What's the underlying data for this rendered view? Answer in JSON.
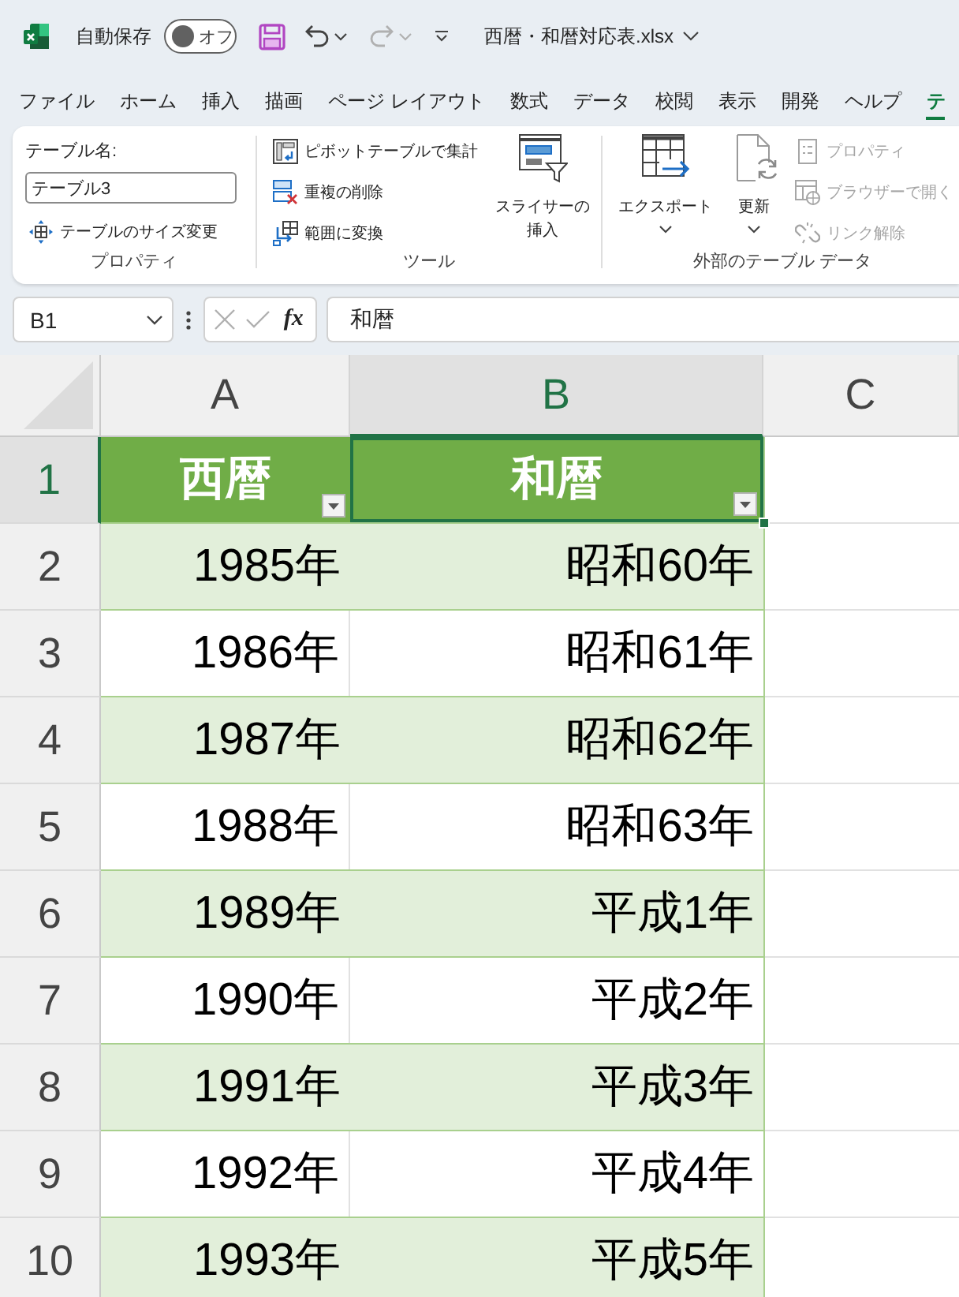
{
  "title_bar": {
    "autosave_label": "自動保存",
    "autosave_toggle": {
      "label": "オフ",
      "on": false
    },
    "undo": {
      "disabled": false
    },
    "redo": {
      "disabled": true
    },
    "file_name": "西暦・和暦対応表.xlsx"
  },
  "ribbon_tabs": [
    {
      "label": "ファイル",
      "selected": false
    },
    {
      "label": "ホーム",
      "selected": false
    },
    {
      "label": "挿入",
      "selected": false
    },
    {
      "label": "描画",
      "selected": false
    },
    {
      "label": "ページ レイアウト",
      "selected": false
    },
    {
      "label": "数式",
      "selected": false
    },
    {
      "label": "データ",
      "selected": false
    },
    {
      "label": "校閲",
      "selected": false
    },
    {
      "label": "表示",
      "selected": false
    },
    {
      "label": "開発",
      "selected": false
    },
    {
      "label": "ヘルプ",
      "selected": false
    },
    {
      "label": "テ",
      "selected": true
    }
  ],
  "ribbon": {
    "groups": [
      {
        "kind": "properties",
        "label": "プロパティ",
        "name_label": "テーブル名:",
        "name_value": "テーブル3",
        "buttons": [
          {
            "kind": "resize",
            "label": "テーブルのサイズ変更",
            "disabled": false
          }
        ]
      },
      {
        "kind": "tools",
        "label": "ツール",
        "buttons": [
          {
            "kind": "pivot",
            "label": "ピボットテーブルで集計",
            "disabled": false
          },
          {
            "kind": "dedupe",
            "label": "重複の削除",
            "disabled": false
          },
          {
            "kind": "convert",
            "label": "範囲に変換",
            "disabled": false
          }
        ],
        "large_buttons": [
          {
            "kind": "slicer",
            "label": "スライサーの挿入",
            "dropdown": false
          }
        ]
      },
      {
        "kind": "external",
        "label": "外部のテーブル データ",
        "large_buttons": [
          {
            "kind": "export",
            "label": "エクスポート",
            "dropdown": true
          },
          {
            "kind": "refresh",
            "label": "更新",
            "dropdown": true
          }
        ],
        "buttons": [
          {
            "kind": "properties",
            "label": "プロパティ",
            "disabled": true
          },
          {
            "kind": "browser",
            "label": "ブラウザーで開く",
            "disabled": true
          },
          {
            "kind": "unlink",
            "label": "リンク解除",
            "disabled": true
          }
        ]
      }
    ]
  },
  "formula_bar": {
    "name_box": "B1",
    "function_button": "fx",
    "formula": "和暦"
  },
  "sheet": {
    "columns": [
      {
        "label": "A",
        "selected": false
      },
      {
        "label": "B",
        "selected": true
      },
      {
        "label": "C",
        "selected": false
      }
    ],
    "rows": [
      {
        "number": "1",
        "selected": true,
        "kind": "header",
        "cells": [
          {
            "text": "西暦",
            "selected": false,
            "filter": true
          },
          {
            "text": "和暦",
            "selected": true,
            "filter": true
          }
        ]
      },
      {
        "number": "2",
        "selected": false,
        "kind": "data",
        "shaded": true,
        "cells": [
          {
            "text": "1985年",
            "selected": false
          },
          {
            "text": "昭和60年",
            "selected": false
          }
        ]
      },
      {
        "number": "3",
        "selected": false,
        "kind": "data",
        "shaded": false,
        "cells": [
          {
            "text": "1986年",
            "selected": false
          },
          {
            "text": "昭和61年",
            "selected": false
          }
        ]
      },
      {
        "number": "4",
        "selected": false,
        "kind": "data",
        "shaded": true,
        "cells": [
          {
            "text": "1987年",
            "selected": false
          },
          {
            "text": "昭和62年",
            "selected": false
          }
        ]
      },
      {
        "number": "5",
        "selected": false,
        "kind": "data",
        "shaded": false,
        "cells": [
          {
            "text": "1988年",
            "selected": false
          },
          {
            "text": "昭和63年",
            "selected": false
          }
        ]
      },
      {
        "number": "6",
        "selected": false,
        "kind": "data",
        "shaded": true,
        "cells": [
          {
            "text": "1989年",
            "selected": false
          },
          {
            "text": "平成1年",
            "selected": false
          }
        ]
      },
      {
        "number": "7",
        "selected": false,
        "kind": "data",
        "shaded": false,
        "cells": [
          {
            "text": "1990年",
            "selected": false
          },
          {
            "text": "平成2年",
            "selected": false
          }
        ]
      },
      {
        "number": "8",
        "selected": false,
        "kind": "data",
        "shaded": true,
        "cells": [
          {
            "text": "1991年",
            "selected": false
          },
          {
            "text": "平成3年",
            "selected": false
          }
        ]
      },
      {
        "number": "9",
        "selected": false,
        "kind": "data",
        "shaded": false,
        "cells": [
          {
            "text": "1992年",
            "selected": false
          },
          {
            "text": "平成4年",
            "selected": false
          }
        ]
      },
      {
        "number": "10",
        "selected": false,
        "kind": "data",
        "shaded": true,
        "cells": [
          {
            "text": "1993年",
            "selected": false
          },
          {
            "text": "平成5年",
            "selected": false
          }
        ]
      }
    ]
  }
}
